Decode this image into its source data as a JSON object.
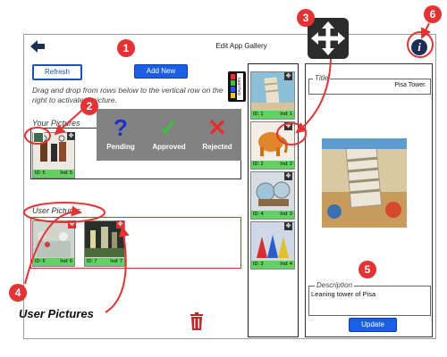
{
  "header": {
    "title": "Edit App Gallery"
  },
  "toolbar": {
    "refresh_label": "Refresh",
    "add_new_label": "Add New"
  },
  "instructions": "Drag and drop from rows below to the vertical row on the right to activate a picture.",
  "your_pictures": {
    "label": "Your Pictures",
    "items": [
      {
        "id": "ID: 5",
        "ind": "Ind: 5"
      }
    ]
  },
  "user_pictures": {
    "label": "User Pictures",
    "items": [
      {
        "id": "ID: 6",
        "ind": "Ind: 6"
      },
      {
        "id": "ID: 7",
        "ind": "Ind: 7"
      }
    ]
  },
  "status_overlay": {
    "pending": {
      "symbol": "?",
      "label": "Pending",
      "color": "#1a33c9"
    },
    "approved": {
      "symbol": "✓",
      "label": "Approved",
      "color": "#3fbf3f"
    },
    "rejected": {
      "symbol": "✕",
      "label": "Rejected",
      "color": "#e03030"
    }
  },
  "gallery_tab": {
    "label": "GALLERY"
  },
  "active_gallery": [
    {
      "id": "ID: 1",
      "ind": "Ind: 1"
    },
    {
      "id": "ID: 2",
      "ind": "Ind: 2"
    },
    {
      "id": "ID: 4",
      "ind": "Ind: 3"
    },
    {
      "id": "ID: 3",
      "ind": "Ind: 4"
    }
  ],
  "detail": {
    "title_label": "Title",
    "title_value": "Pisa Tower.",
    "description_label": "Description",
    "description_value": "Leaning tower of Pisa",
    "update_label": "Update"
  },
  "annotations": {
    "c1": "1",
    "c2": "2",
    "c3": "3",
    "c4": "4",
    "c5": "5",
    "c6": "6",
    "user_pictures_caption": "User Pictures"
  },
  "colors": {
    "accent": "#1b5fe6",
    "callout": "#e53232",
    "approved": "#3fbf3f"
  }
}
